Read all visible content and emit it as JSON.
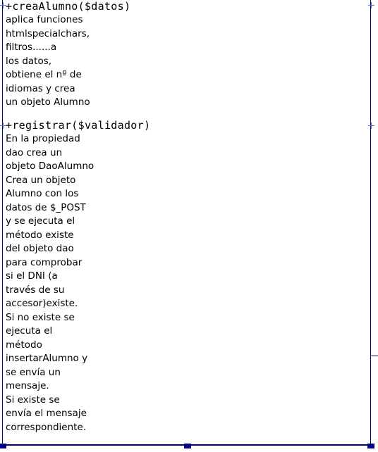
{
  "methods": [
    {
      "signature": "+creaAlumno($datos)",
      "notes": [
        "aplica funciones",
        "htmlspecialchars,",
        "filtros......a",
        "los datos,",
        "obtiene el nº de",
        "idiomas y crea",
        "un objeto Alumno"
      ]
    },
    {
      "signature": "+registrar($validador)",
      "notes": [
        "En la propiedad",
        "dao crea un",
        "objeto DaoAlumno",
        "Crea un objeto",
        "Alumno con los",
        "datos de $_POST",
        "y se ejecuta el",
        "método existe",
        "del objeto dao",
        "para comprobar",
        "si el DNI (a",
        "través de su",
        "accesor)existe.",
        "Si no existe se",
        "ejecuta el",
        "método",
        "insertarAlumno y",
        "se envía un",
        "mensaje.",
        "Si existe se",
        "envía el mensaje",
        "correspondiente."
      ]
    }
  ],
  "colors": {
    "border": "#000080",
    "anchor": "#6070c8",
    "text": "#000000"
  }
}
